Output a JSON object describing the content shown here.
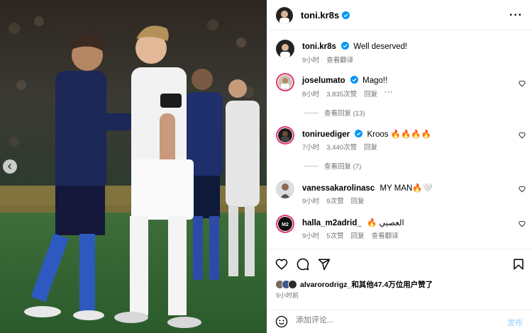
{
  "post": {
    "author": "toni.kr8s",
    "caption_author": "toni.kr8s",
    "caption": "Well deserved!",
    "caption_time": "9小时",
    "translate_label": "查看翻译"
  },
  "comments": [
    {
      "user": "joselumato",
      "verified": true,
      "text": "Mago!!",
      "time": "8小时",
      "likes": "3,835次赞",
      "reply": "回复",
      "replies": "查看回复 (13)"
    },
    {
      "user": "toniruediger",
      "verified": true,
      "text": "Kroos 🔥🔥🔥🔥",
      "time": "7小时",
      "likes": "3,440次赞",
      "reply": "回复",
      "replies": "查看回复 (7)"
    },
    {
      "user": "vanessakarolinasc",
      "verified": false,
      "text": "MY MAN🔥🤍",
      "time": "9小时",
      "likes": "9次赞",
      "reply": "回复"
    },
    {
      "user": "halla_m2adrid_",
      "verified": false,
      "text": "🔥 العصبي",
      "time": "9小时",
      "likes": "5次赞",
      "reply": "回复",
      "translate": "查看翻译"
    }
  ],
  "likes_summary": {
    "text": "alvarorodrigz_和其他47.4万位用户赞了",
    "time": "9小时前"
  },
  "comment_box": {
    "placeholder": "添加评论...",
    "post_label": "发布"
  },
  "icons": [
    "more-icon",
    "heart-icon",
    "comment-icon",
    "share-icon",
    "bookmark-icon",
    "emoji-icon",
    "verified-icon",
    "chevron-left-icon"
  ],
  "colors": {
    "verified": "#0095f6",
    "meta": "#737373",
    "post_disabled": "#b2dffc"
  }
}
